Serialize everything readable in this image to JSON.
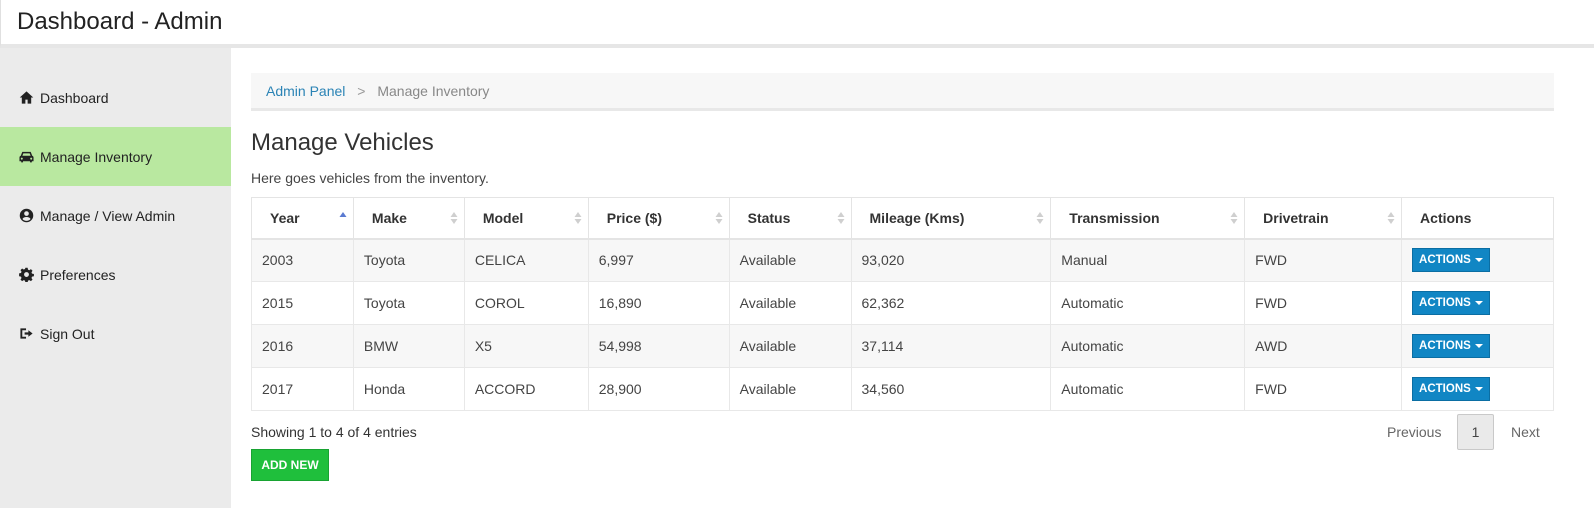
{
  "header": {
    "title": "Dashboard - Admin"
  },
  "sidebar": {
    "items": [
      {
        "label": "Dashboard",
        "icon": "home-icon"
      },
      {
        "label": "Manage Inventory",
        "icon": "car-icon",
        "active": true
      },
      {
        "label": "Manage / View Admin",
        "icon": "user-circle-icon"
      },
      {
        "label": "Preferences",
        "icon": "gear-icon"
      },
      {
        "label": "Sign Out",
        "icon": "sign-out-icon"
      }
    ],
    "active_color": "#b9e8a0"
  },
  "breadcrumb": {
    "root": "Admin Panel",
    "separator": ">",
    "current": "Manage Inventory"
  },
  "main": {
    "title": "Manage Vehicles",
    "description": "Here goes vehicles from the inventory."
  },
  "table": {
    "columns": [
      "Year",
      "Make",
      "Model",
      "Price ($)",
      "Status",
      "Mileage (Kms)",
      "Transmission",
      "Drivetrain",
      "Actions"
    ],
    "sorted_column": "Year",
    "sort_direction": "ascending",
    "rows": [
      [
        "2003",
        "Toyota",
        "CELICA",
        "6,997",
        "Available",
        "93,020",
        "Manual",
        "FWD"
      ],
      [
        "2015",
        "Toyota",
        "COROL",
        "16,890",
        "Available",
        "62,362",
        "Automatic",
        "FWD"
      ],
      [
        "2016",
        "BMW",
        "X5",
        "54,998",
        "Available",
        "37,114",
        "Automatic",
        "AWD"
      ],
      [
        "2017",
        "Honda",
        "ACCORD",
        "28,900",
        "Available",
        "34,560",
        "Automatic",
        "FWD"
      ]
    ],
    "action_label": "ACTIONS",
    "action_color": "#1186c4"
  },
  "footer": {
    "showing": "Showing 1 to 4 of 4 entries",
    "add_new": "ADD NEW",
    "add_new_color": "#1fbf3c",
    "pagination": {
      "previous": "Previous",
      "page": "1",
      "next": "Next"
    }
  }
}
